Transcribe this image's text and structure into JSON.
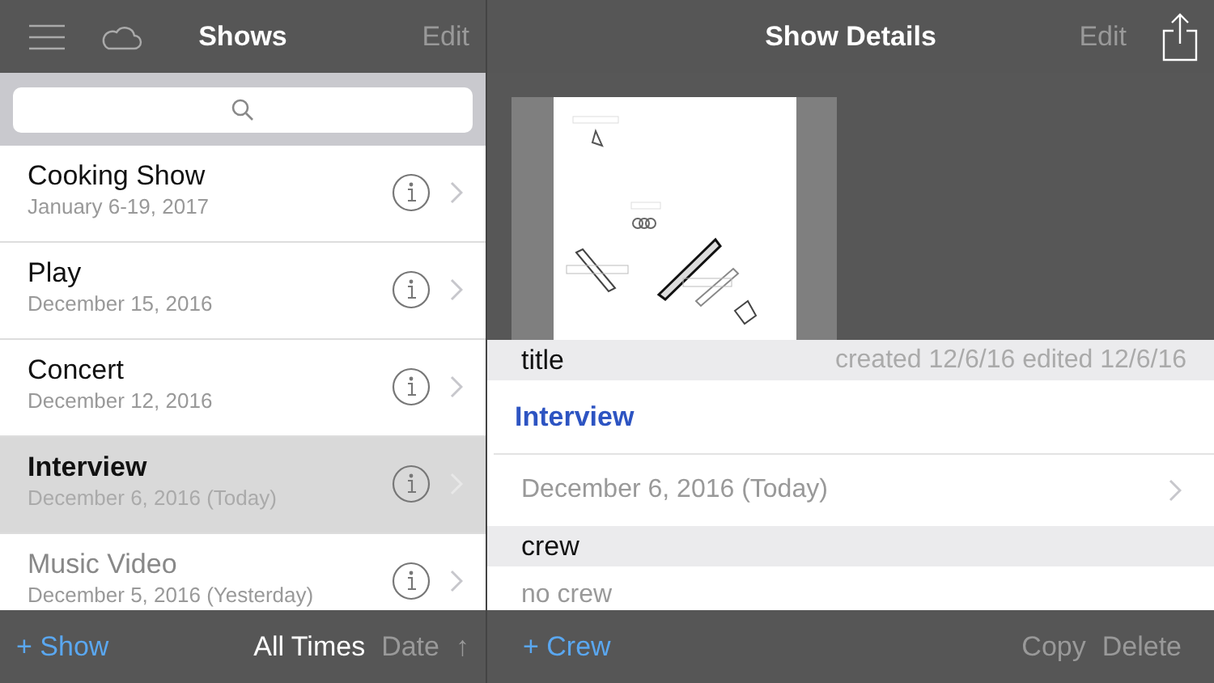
{
  "shows_panel": {
    "title": "Shows",
    "edit": "Edit",
    "items": [
      {
        "name": "Cooking Show",
        "date": "January 6-19, 2017",
        "selected": false,
        "dimmed": false
      },
      {
        "name": "Play",
        "date": "December 15, 2016",
        "selected": false,
        "dimmed": false
      },
      {
        "name": "Concert",
        "date": "December 12, 2016",
        "selected": false,
        "dimmed": false
      },
      {
        "name": "Interview",
        "date": "December 6, 2016 (Today)",
        "selected": true,
        "dimmed": false
      },
      {
        "name": "Music Video",
        "date": "December 5, 2016 (Yesterday)",
        "selected": false,
        "dimmed": true
      }
    ],
    "footer": {
      "add": "+ Show",
      "filter": "All Times",
      "sort": "Date",
      "direction": "↑"
    }
  },
  "details_panel": {
    "title": "Show Details",
    "edit": "Edit",
    "sections": [
      {
        "header": "title",
        "meta": "created 12/6/16 edited 12/6/16",
        "rows": [
          {
            "kind": "title",
            "text": "Interview"
          },
          {
            "kind": "date",
            "text": "December 6, 2016 (Today)"
          }
        ]
      },
      {
        "header": "crew",
        "rows": [
          {
            "kind": "empty",
            "text": "no crew"
          }
        ]
      }
    ],
    "footer": {
      "add": "+ Crew",
      "copy": "Copy",
      "delete": "Delete"
    }
  }
}
